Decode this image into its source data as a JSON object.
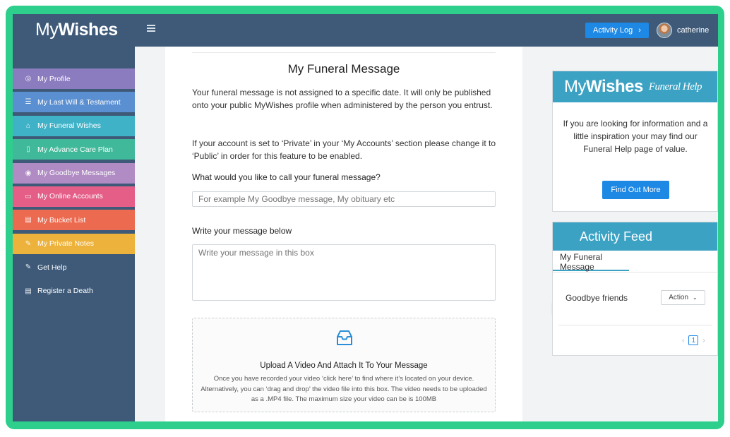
{
  "header": {
    "logo_light": "My",
    "logo_bold": "Wishes",
    "activity_log_label": "Activity Log",
    "username": "catherine"
  },
  "sidebar": {
    "items": [
      {
        "label": "My Profile",
        "color": "#8b7bbf",
        "icon": "user-circle-icon"
      },
      {
        "label": "My Last Will & Testament",
        "color": "#5a8fd1",
        "icon": "scroll-icon"
      },
      {
        "label": "My Funeral Wishes",
        "color": "#3fb2c8",
        "icon": "headstone-icon"
      },
      {
        "label": "My Advance Care Plan",
        "color": "#40b99a",
        "icon": "document-icon"
      },
      {
        "label": "My Goodbye Messages",
        "color": "#b08bc4",
        "icon": "fingerprint-icon"
      },
      {
        "label": "My Online Accounts",
        "color": "#e45e88",
        "icon": "laptop-icon"
      },
      {
        "label": "My Bucket List",
        "color": "#ec6a4f",
        "icon": "bucket-icon"
      },
      {
        "label": "My Private Notes",
        "color": "#edb23b",
        "icon": "notes-icon"
      },
      {
        "label": "Get Help",
        "color": "",
        "icon": "edit-icon"
      },
      {
        "label": "Register a Death",
        "color": "",
        "icon": "form-icon"
      }
    ]
  },
  "main": {
    "title": "My Funeral Message",
    "intro_1": "Your funeral message is not assigned to a specific date. It will only be published onto your public MyWishes profile when administered by the person you entrust.",
    "intro_2": "If your account is set to ‘Private’ in your ‘My Accounts’ section please change it to ‘Public’ in order for this feature to be enabled.",
    "name_label": "What would you like to call your funeral message?",
    "name_placeholder": "For example My Goodbye message, My obituary etc",
    "message_label": "Write your message below",
    "message_placeholder": "Write your message in this box",
    "upload_title": "Upload A Video And Attach It To Your Message",
    "upload_desc": "Once you have recorded your video ‘click here’ to find where it’s located on your device. Alternatively, you can ‘drag and drop’ the video file into this box. The video needs to be uploaded as a .MP4 file. The maximum size your video can be is 100MB"
  },
  "help_panel": {
    "logo_light": "My",
    "logo_bold": "Wishes",
    "subtitle": "Funeral Help",
    "text": "If you are looking for information and a little inspiration your may find our Funeral Help page of value.",
    "button_label": "Find Out More"
  },
  "feed": {
    "title": "Activity Feed",
    "tab": "My Funeral Message",
    "row_title": "Goodbye friends",
    "action_label": "Action",
    "page": "1"
  },
  "colors": {
    "accent": "#1e88e5",
    "sidebar_bg": "#3e5a78",
    "frame": "#2ecf8c",
    "panel_header": "#3ca2c4"
  }
}
